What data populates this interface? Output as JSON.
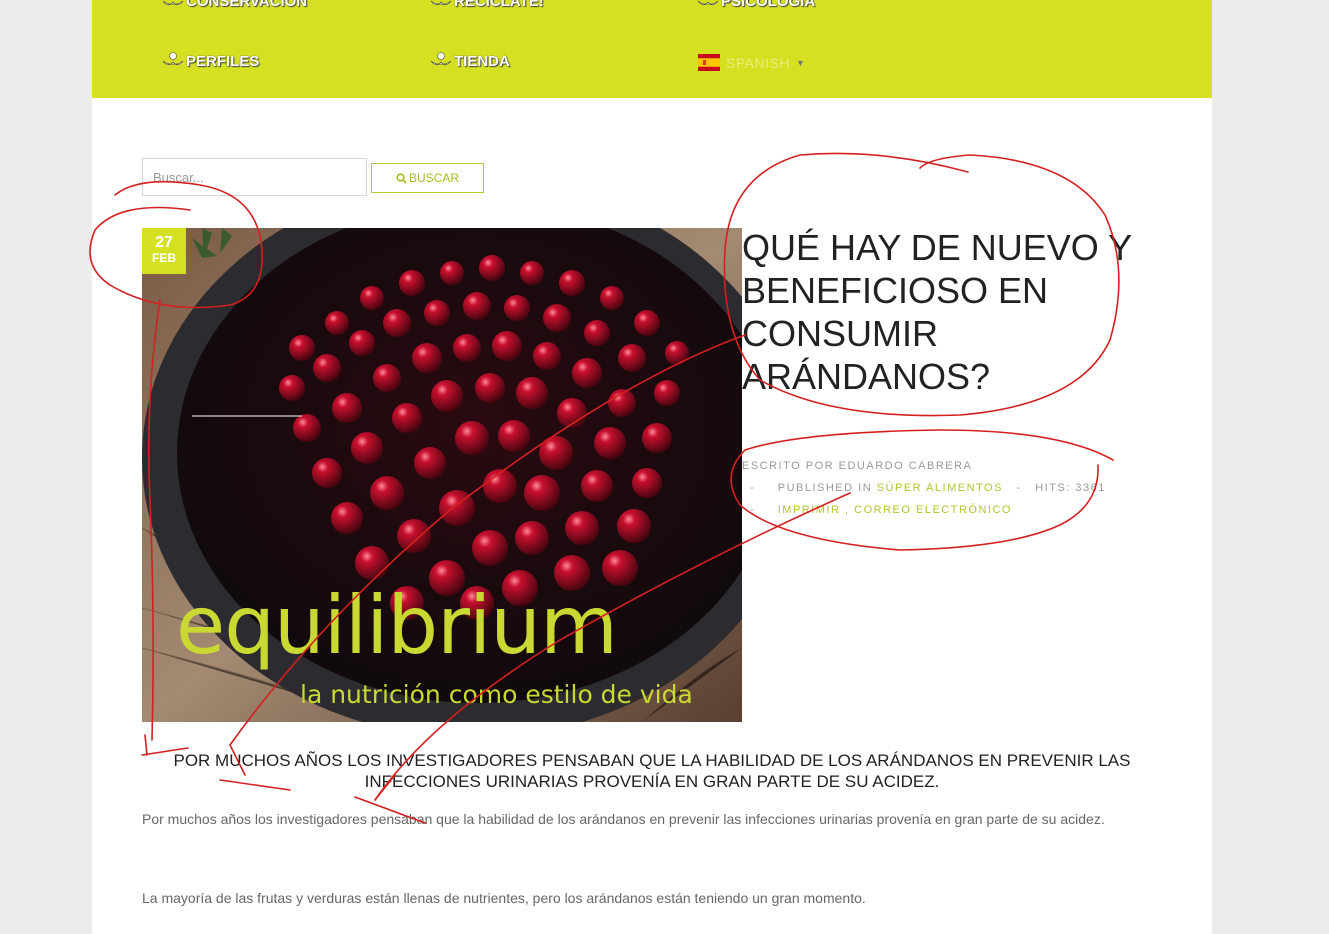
{
  "nav": {
    "items": [
      {
        "label": "CONSERVACIÓN",
        "name": "nav-item-conservacion"
      },
      {
        "label": "RECÍCLATE!",
        "name": "nav-item-reciclate"
      },
      {
        "label": "PSICOLOGÍA",
        "name": "nav-item-psicologia"
      },
      {
        "label": "PERFILES",
        "name": "nav-item-perfiles"
      },
      {
        "label": "TIENDA",
        "name": "nav-item-tienda"
      }
    ],
    "language": {
      "label": "SPANISH",
      "flag": "spain-flag-icon"
    }
  },
  "search": {
    "placeholder": "Buscar...",
    "button_label": "BUSCAR"
  },
  "article": {
    "date": {
      "day": "27",
      "month": "FEB"
    },
    "image": {
      "brand": "equilibrium",
      "tagline": "la nutrición como estilo de vida"
    },
    "title": "QUÉ HAY DE NUEVO Y BENEFICIOSO EN CONSUMIR ARÁNDANOS?",
    "meta": {
      "author": "ESCRITO POR EDUARDO CABRERA",
      "published_prefix": "PUBLISHED IN",
      "category": "SÚPER ALIMENTOS",
      "hits": "HITS: 3361",
      "print": "IMPRIMIR",
      "comma": ",",
      "email": "CORREO ELECTRÓNICO",
      "dash": "-"
    },
    "lead": "POR MUCHOS AÑOS LOS INVESTIGADORES PENSABAN QUE LA HABILIDAD DE LOS ARÁNDANOS EN PREVENIR LAS INFECCIONES URINARIAS PROVENÍA EN GRAN PARTE DE SU ACIDEZ.",
    "paragraphs": [
      "Por muchos años los investigadores pensaban que la habilidad de los arándanos en prevenir las infecciones urinarias provenía en gran parte de su acidez.",
      "La mayoría de las frutas y verduras están llenas de nutrientes, pero los arándanos están teniendo un gran momento."
    ]
  },
  "colors": {
    "accent": "#d6e022",
    "link": "#b5c42a",
    "annotation": "#d42020"
  }
}
